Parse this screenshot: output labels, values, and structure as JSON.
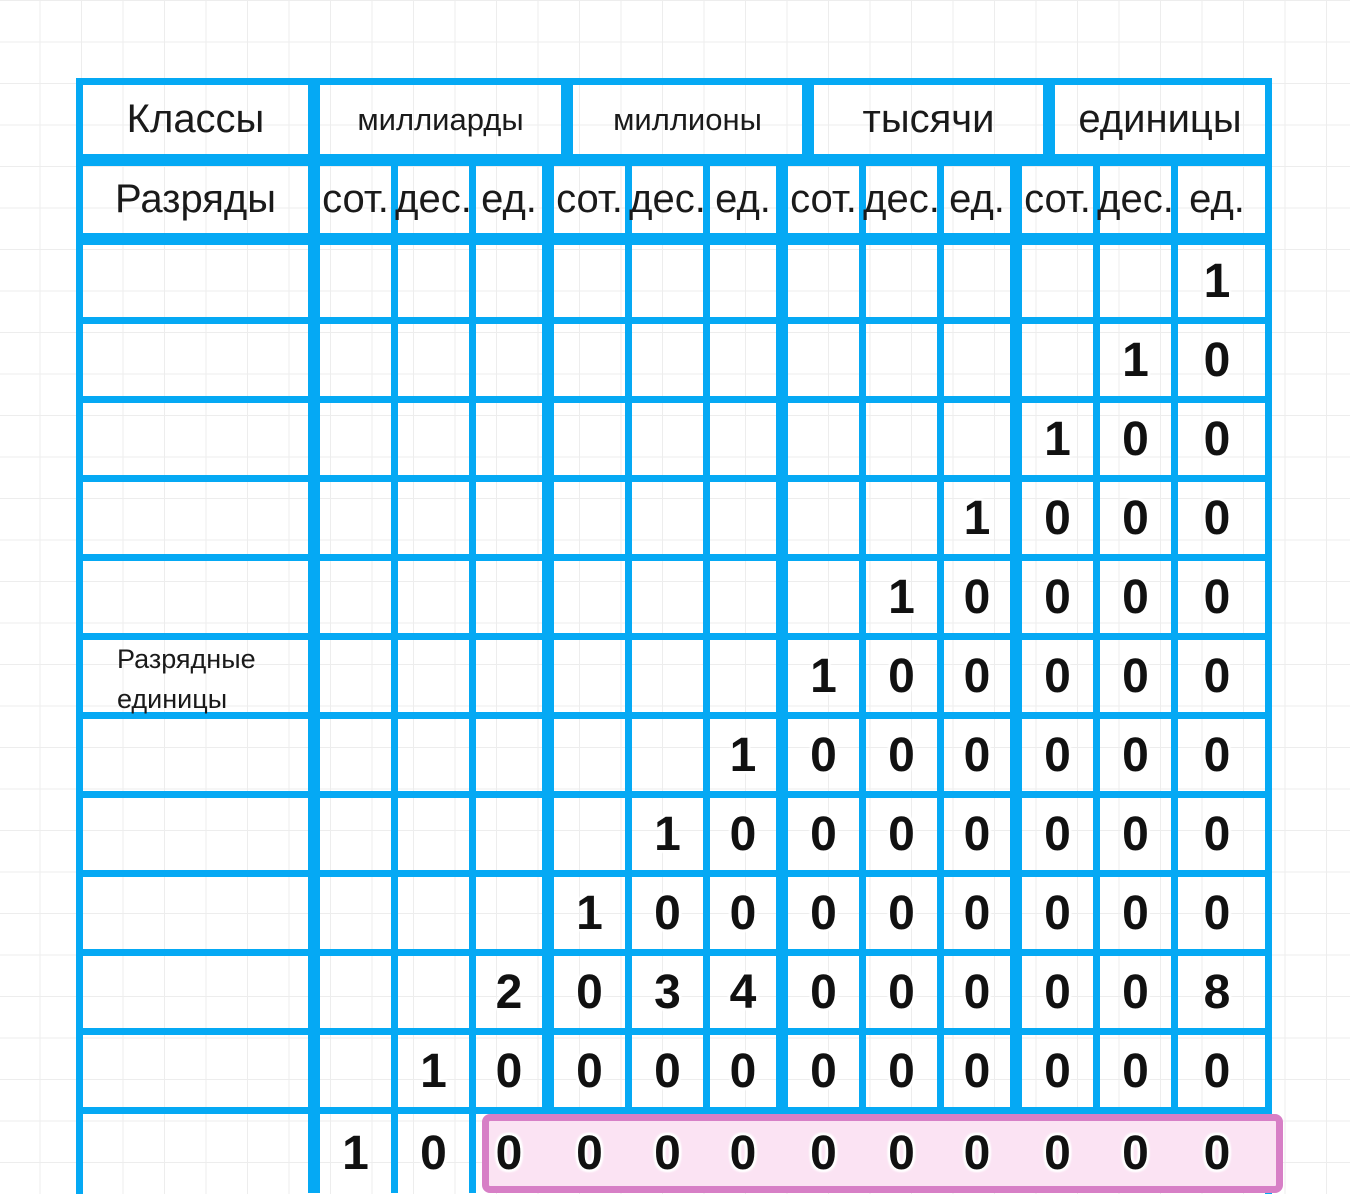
{
  "table": {
    "corner_labels": {
      "classes": "Классы",
      "ranks": "Разряды",
      "side": "Разрядные\nединицы"
    },
    "classes": [
      {
        "name": "миллиарды",
        "size": 3
      },
      {
        "name": "миллионы",
        "size": 3
      },
      {
        "name": "тысячи",
        "size": 3
      },
      {
        "name": "единицы",
        "size": 3
      }
    ],
    "ranks": [
      "сот.",
      "дес.",
      "ед.",
      "сот.",
      "дес.",
      "ед.",
      "сот.",
      "дес.",
      "ед.",
      "сот.",
      "дес.",
      "ед."
    ],
    "rows": [
      {
        "digits": [
          "",
          "",
          "",
          "",
          "",
          "",
          "",
          "",
          "",
          "",
          "",
          "1"
        ],
        "highlight": false
      },
      {
        "digits": [
          "",
          "",
          "",
          "",
          "",
          "",
          "",
          "",
          "",
          "",
          "1",
          "0"
        ],
        "highlight": false
      },
      {
        "digits": [
          "",
          "",
          "",
          "",
          "",
          "",
          "",
          "",
          "",
          "1",
          "0",
          "0"
        ],
        "highlight": false
      },
      {
        "digits": [
          "",
          "",
          "",
          "",
          "",
          "",
          "",
          "",
          "1",
          "0",
          "0",
          "0"
        ],
        "highlight": false
      },
      {
        "digits": [
          "",
          "",
          "",
          "",
          "",
          "",
          "",
          "1",
          "0",
          "0",
          "0",
          "0"
        ],
        "highlight": false
      },
      {
        "digits": [
          "",
          "",
          "",
          "",
          "",
          "",
          "1",
          "0",
          "0",
          "0",
          "0",
          "0"
        ],
        "highlight": false
      },
      {
        "digits": [
          "",
          "",
          "",
          "",
          "",
          "1",
          "0",
          "0",
          "0",
          "0",
          "0",
          "0"
        ],
        "highlight": false
      },
      {
        "digits": [
          "",
          "",
          "",
          "",
          "1",
          "0",
          "0",
          "0",
          "0",
          "0",
          "0",
          "0"
        ],
        "highlight": false
      },
      {
        "digits": [
          "",
          "",
          "",
          "1",
          "0",
          "0",
          "0",
          "0",
          "0",
          "0",
          "0",
          "0"
        ],
        "highlight": false
      },
      {
        "digits": [
          "",
          "",
          "2",
          "0",
          "3",
          "4",
          "0",
          "0",
          "0",
          "0",
          "0",
          "8"
        ],
        "highlight": true
      },
      {
        "digits": [
          "",
          "1",
          "0",
          "0",
          "0",
          "0",
          "0",
          "0",
          "0",
          "0",
          "0",
          "0"
        ],
        "highlight": false
      },
      {
        "digits": [
          "1",
          "0",
          "0",
          "0",
          "0",
          "0",
          "0",
          "0",
          "0",
          "0",
          "0",
          "0"
        ],
        "highlight": false
      }
    ]
  },
  "colors": {
    "grid_blue": "#05a9f4",
    "highlight_border": "#d77fc6",
    "highlight_fill": "#fbe3f3",
    "text": "#1a1a1a",
    "paper_grid": "#ededed"
  }
}
